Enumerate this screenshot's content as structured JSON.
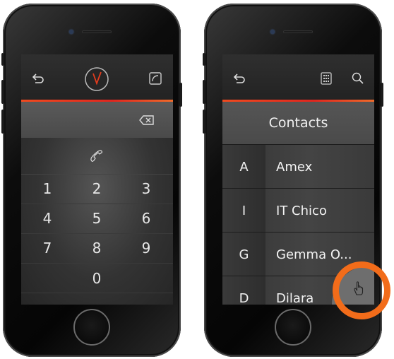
{
  "dialer": {
    "back_icon": "back-arrow-icon",
    "clock_icon": "clock-logo-icon",
    "minimize_icon": "phone-minimize-icon",
    "backspace_icon": "backspace-icon",
    "call_icon": "handset-icon",
    "keys": [
      "1",
      "2",
      "3",
      "4",
      "5",
      "6",
      "7",
      "8",
      "9",
      "0"
    ]
  },
  "contacts": {
    "back_icon": "back-arrow-icon",
    "keypad_icon": "keypad-icon",
    "search_icon": "search-icon",
    "title": "Contacts",
    "rows": [
      {
        "letter": "A",
        "name": "Amex"
      },
      {
        "letter": "I",
        "name": "IT Chico"
      },
      {
        "letter": "G",
        "name": "Gemma O..."
      },
      {
        "letter": "D",
        "name": "Dilara"
      }
    ],
    "corner_icon": "hand-cursor-icon"
  },
  "colors": {
    "accent": "#e33c1e",
    "highlight_ring": "#f26c1a"
  }
}
